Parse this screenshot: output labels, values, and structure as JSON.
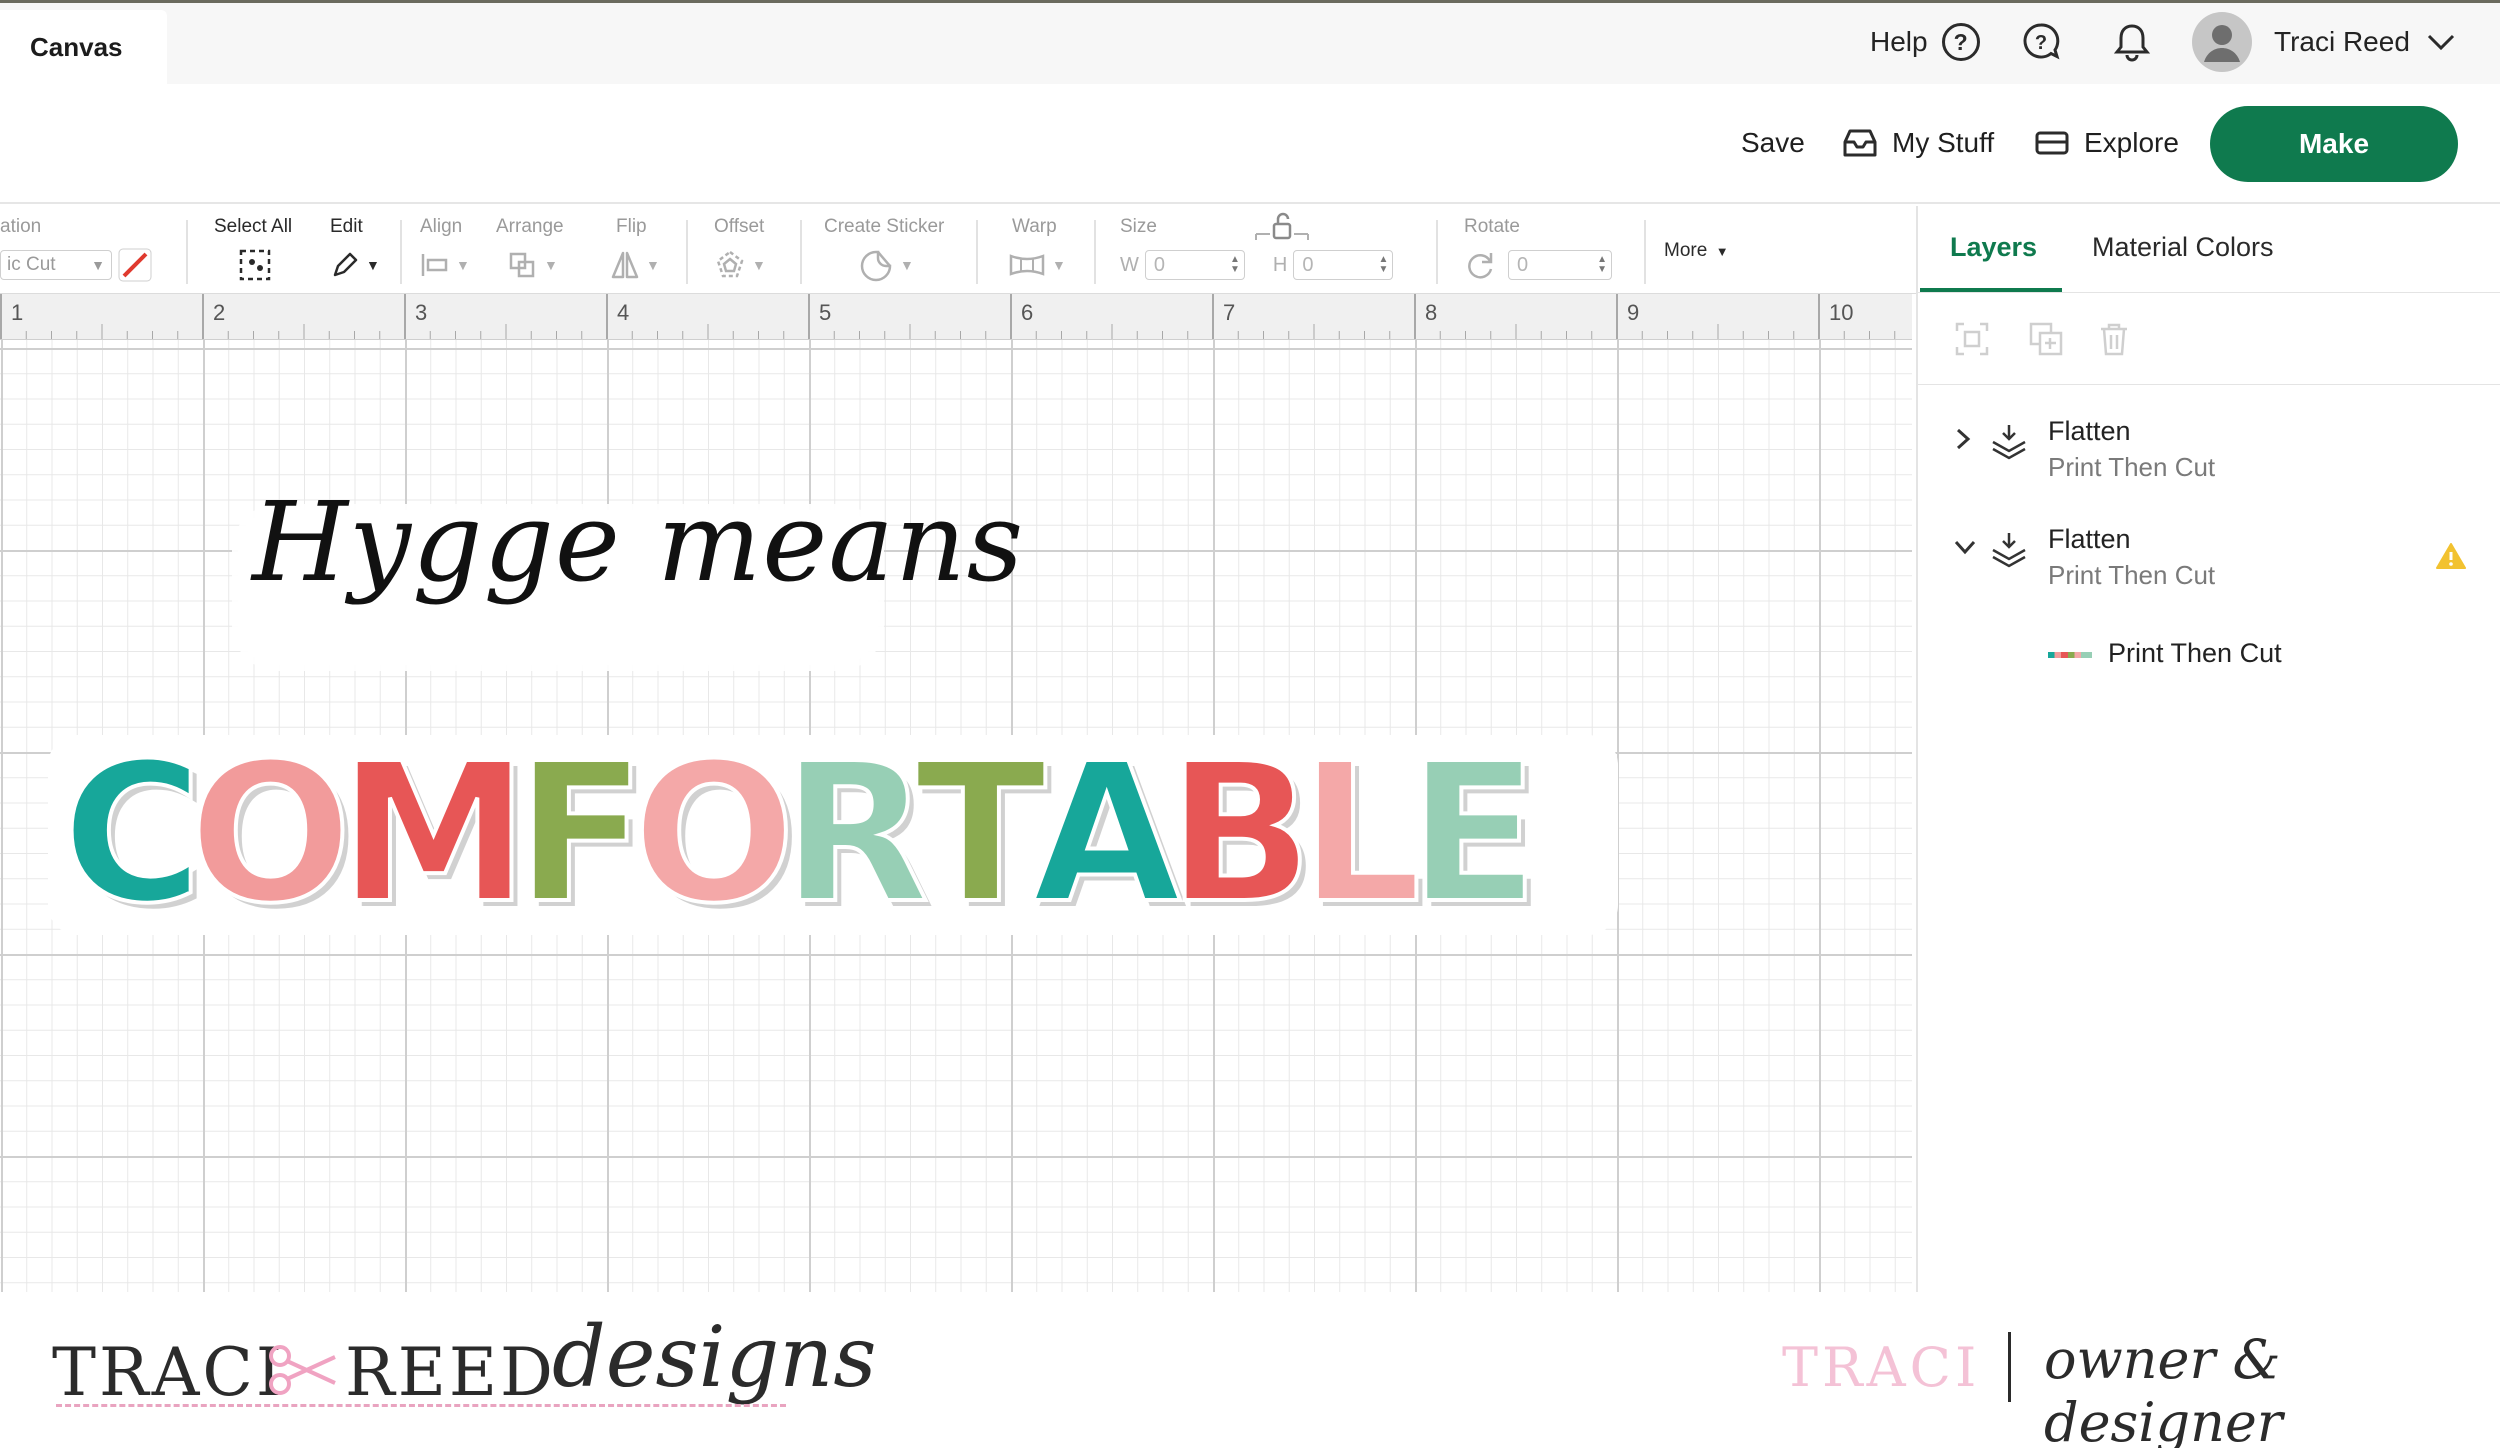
{
  "topbar": {
    "tab_label": "Canvas",
    "help_label": "Help",
    "help_glyph": "?",
    "user_name": "Traci Reed"
  },
  "actionbar": {
    "save": "Save",
    "my_stuff": "My Stuff",
    "explore": "Explore",
    "make": "Make",
    "make_color": "#0f7a4e"
  },
  "toolbar": {
    "operation_label": "ation",
    "operation_value": "ic Cut",
    "select_all": "Select All",
    "edit": "Edit",
    "align": "Align",
    "arrange": "Arrange",
    "flip": "Flip",
    "offset": "Offset",
    "create_sticker": "Create Sticker",
    "warp": "Warp",
    "size": "Size",
    "size_w_label": "W",
    "size_w_value": "0",
    "size_h_label": "H",
    "size_h_value": "0",
    "rotate": "Rotate",
    "rotate_value": "0",
    "more": "More"
  },
  "ruler": {
    "labels": [
      "1",
      "2",
      "3",
      "4",
      "5",
      "6",
      "7",
      "8",
      "9",
      "10"
    ]
  },
  "canvas": {
    "text_line": "Hygge means",
    "word_letters": [
      "C",
      "O",
      "M",
      "F",
      "O",
      "R",
      "T",
      "A",
      "B",
      "L",
      "E"
    ],
    "word_colors": [
      "#17a79a",
      "#f29b9b",
      "#e75656",
      "#8aaa4f",
      "#f4a8a8",
      "#97cfb5",
      "#8aaa4f",
      "#17a79a",
      "#e75656",
      "#f4a8a8",
      "#97cfb5"
    ]
  },
  "panel": {
    "tabs": [
      "Layers",
      "Material Colors"
    ],
    "layers": [
      {
        "name": "Flatten",
        "sub": "Print Then Cut",
        "expanded": false,
        "warning": false
      },
      {
        "name": "Flatten",
        "sub": "Print Then Cut",
        "expanded": true,
        "warning": true
      }
    ],
    "sublayer_name": "Print Then Cut",
    "warning_color": "#f2c230"
  },
  "footer": {
    "brand_first": "TRACI",
    "brand_second": "REED",
    "brand_script": "designs",
    "signature_name": "TRACI",
    "signature_role": "owner & designer",
    "accent_pink": "#f4c2d6"
  }
}
